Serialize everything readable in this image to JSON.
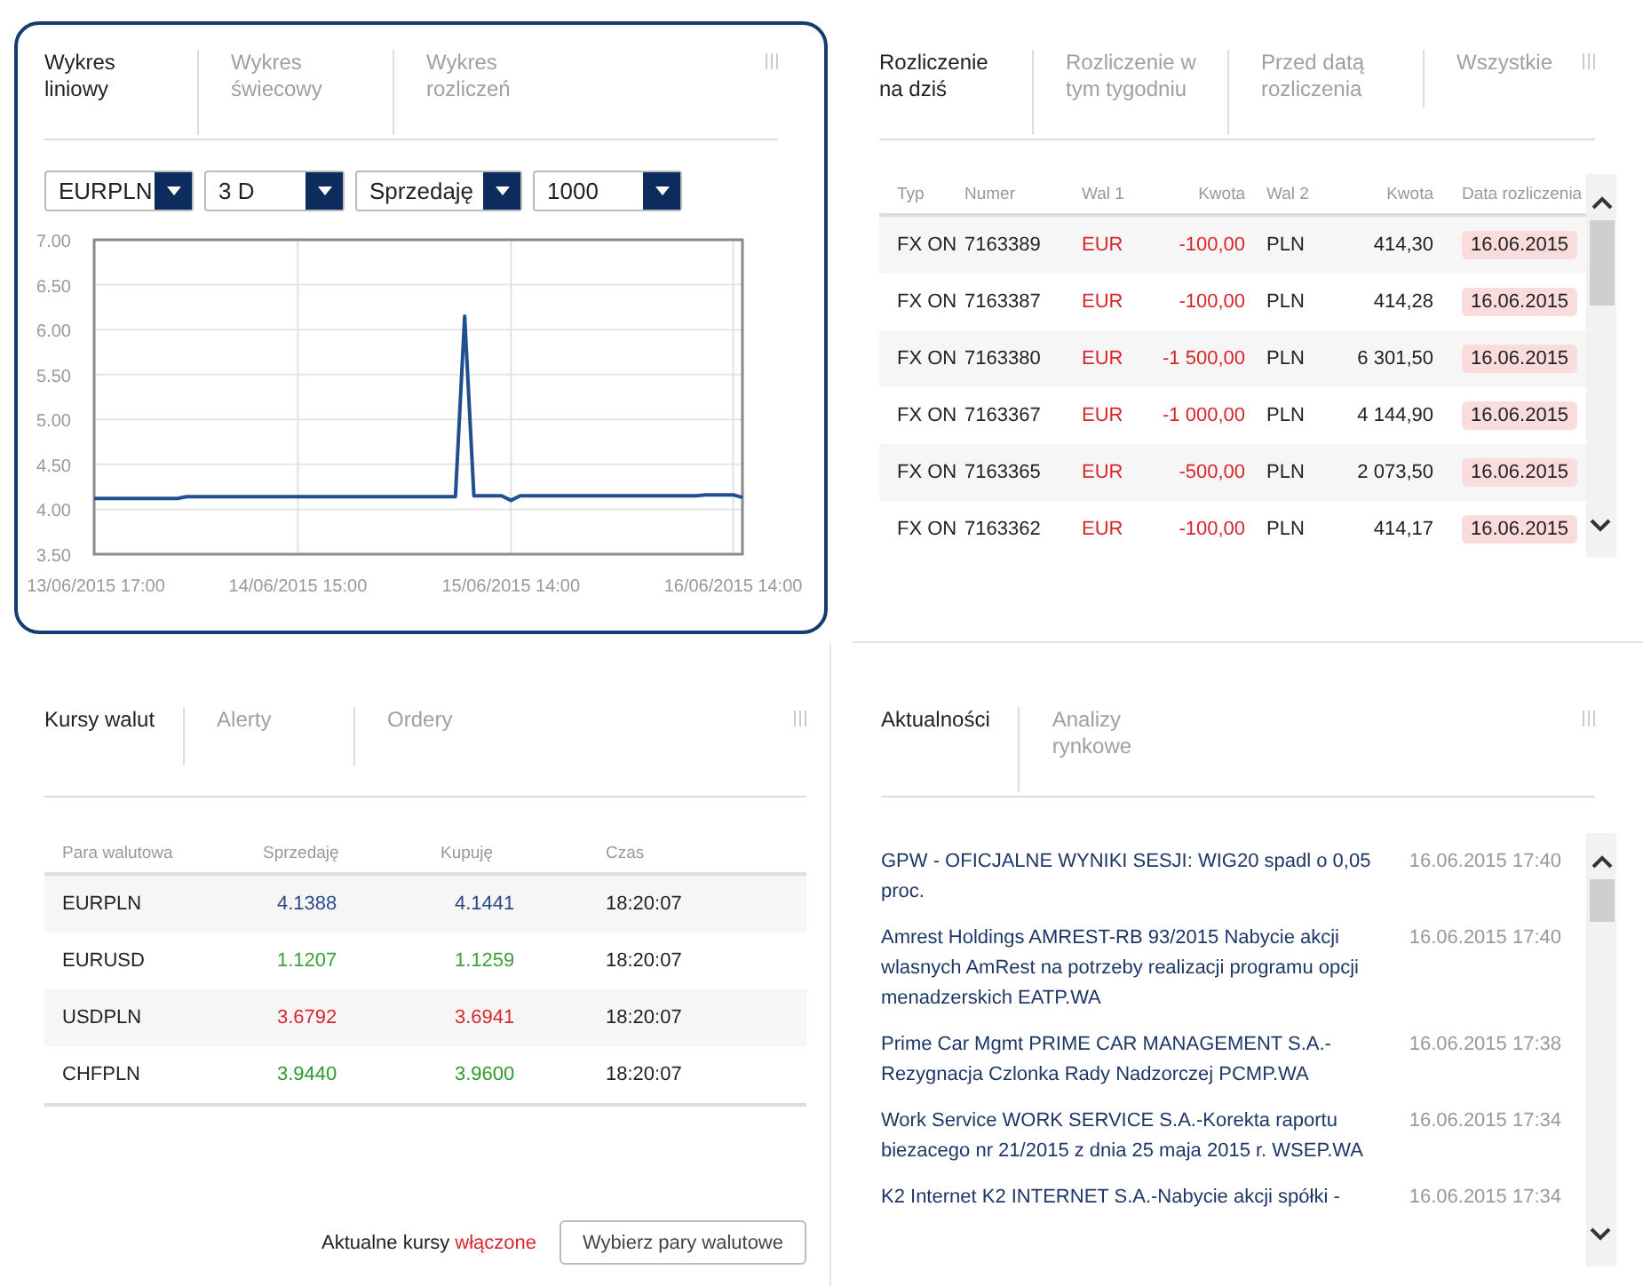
{
  "chart_panel": {
    "tabs": [
      {
        "label": "Wykres liniowy",
        "selected": true
      },
      {
        "label": "Wykres świecowy",
        "selected": false
      },
      {
        "label": "Wykres rozliczeń",
        "selected": false
      }
    ],
    "selects": [
      {
        "value": "EURPLN"
      },
      {
        "value": "3 D"
      },
      {
        "value": "Sprzedaję"
      },
      {
        "value": "1000"
      }
    ],
    "chart_data": {
      "type": "line",
      "categories": [
        "13/06/2015 17:00",
        null,
        null,
        null,
        null,
        null,
        null,
        null,
        null,
        null,
        null,
        null,
        null,
        null,
        null,
        null,
        null,
        null,
        null,
        null,
        null,
        null,
        "14/06/2015 15:00",
        null,
        null,
        null,
        null,
        null,
        null,
        null,
        null,
        null,
        null,
        null,
        null,
        null,
        null,
        null,
        null,
        null,
        null,
        null,
        null,
        null,
        null,
        "15/06/2015 14:00",
        null,
        null,
        null,
        null,
        null,
        null,
        null,
        null,
        null,
        null,
        null,
        null,
        null,
        null,
        null,
        null,
        null,
        null,
        null,
        null,
        null,
        null,
        null,
        "16/06/2015 14:00",
        null
      ],
      "series": [
        {
          "color": "#1f4f8f",
          "values": [
            4.12,
            4.12,
            4.12,
            4.12,
            4.12,
            4.12,
            4.12,
            4.12,
            4.12,
            4.12,
            4.14,
            4.14,
            4.14,
            4.14,
            4.14,
            4.14,
            4.14,
            4.14,
            4.14,
            4.14,
            4.14,
            4.14,
            4.14,
            4.14,
            4.14,
            4.14,
            4.14,
            4.14,
            4.14,
            4.14,
            4.14,
            4.14,
            4.14,
            4.14,
            4.14,
            4.14,
            4.14,
            4.14,
            4.14,
            4.14,
            6.15,
            4.15,
            4.15,
            4.15,
            4.15,
            4.1,
            4.15,
            4.15,
            4.15,
            4.15,
            4.15,
            4.15,
            4.15,
            4.15,
            4.15,
            4.15,
            4.15,
            4.15,
            4.15,
            4.15,
            4.15,
            4.15,
            4.15,
            4.15,
            4.15,
            4.15,
            4.16,
            4.16,
            4.16,
            4.16,
            4.13
          ]
        }
      ],
      "ylim": [
        3.5,
        7
      ],
      "grid": true,
      "yticks": [
        {
          "value": 7,
          "label": "7.00"
        },
        {
          "value": 6.5,
          "label": "6.50"
        },
        {
          "value": 6,
          "label": "6.00"
        },
        {
          "value": 5.5,
          "label": "5.50"
        },
        {
          "value": 5,
          "label": "5.00"
        },
        {
          "value": 4.5,
          "label": "4.50"
        },
        {
          "value": 4,
          "label": "4.00"
        },
        {
          "value": 3.5,
          "label": "3.50"
        }
      ]
    }
  },
  "settlement_panel": {
    "tabs": [
      {
        "label": "Rozliczenie na dziś",
        "selected": true
      },
      {
        "label": "Rozliczenie w tym tygodniu",
        "selected": false
      },
      {
        "label": "Przed datą rozliczenia",
        "selected": false
      },
      {
        "label": "Wszystkie",
        "selected": false
      }
    ],
    "table": {
      "columns": [
        "Typ",
        "Numer",
        "Wal 1",
        "Kwota",
        "Wal 2",
        "Kwota",
        "Data rozliczenia"
      ],
      "rows": [
        [
          "FX ON",
          "7163389",
          "EUR",
          "-100,00",
          "PLN",
          "414,30",
          "16.06.2015"
        ],
        [
          "FX ON",
          "7163387",
          "EUR",
          "-100,00",
          "PLN",
          "414,28",
          "16.06.2015"
        ],
        [
          "FX ON",
          "7163380",
          "EUR",
          "-1 500,00",
          "PLN",
          "6 301,50",
          "16.06.2015"
        ],
        [
          "FX ON",
          "7163367",
          "EUR",
          "-1 000,00",
          "PLN",
          "4 144,90",
          "16.06.2015"
        ],
        [
          "FX ON",
          "7163365",
          "EUR",
          "-500,00",
          "PLN",
          "2 073,50",
          "16.06.2015"
        ],
        [
          "FX ON",
          "7163362",
          "EUR",
          "-100,00",
          "PLN",
          "414,17",
          "16.06.2015"
        ]
      ]
    }
  },
  "rates_panel": {
    "tabs": [
      {
        "label": "Kursy walut",
        "selected": true
      },
      {
        "label": "Alerty",
        "selected": false
      },
      {
        "label": "Ordery",
        "selected": false
      }
    ],
    "table": {
      "columns": [
        "Para walutowa",
        "Sprzedaję",
        "Kupuję",
        "Czas"
      ],
      "rows": [
        {
          "pair": "EURPLN",
          "sell": "4.1388",
          "buy": "4.1441",
          "time": "18:20:07",
          "color": "#2c4a8a"
        },
        {
          "pair": "EURUSD",
          "sell": "1.1207",
          "buy": "1.1259",
          "time": "18:20:07",
          "color": "#3aa33a"
        },
        {
          "pair": "USDPLN",
          "sell": "3.6792",
          "buy": "3.6941",
          "time": "18:20:07",
          "color": "#d9262b"
        },
        {
          "pair": "CHFPLN",
          "sell": "3.9440",
          "buy": "3.9600",
          "time": "18:20:07",
          "color": "#2e9a2e"
        }
      ]
    },
    "footer": {
      "label": "Aktualne kursy",
      "status": "włączone",
      "button": "Wybierz pary walutowe"
    }
  },
  "news_panel": {
    "tabs": [
      {
        "label": "Aktualności",
        "selected": true
      },
      {
        "label": "Analizy rynkowe",
        "selected": false
      }
    ],
    "items": [
      {
        "headline": "GPW - OFICJALNE WYNIKI SESJI: WIG20 spadl o 0,05 proc.",
        "time": "16.06.2015 17:40"
      },
      {
        "headline": "Amrest Holdings AMREST-RB 93/2015 Nabycie akcji wlasnych AmRest na potrzeby realizacji programu opcji menadzerskich EATP.WA",
        "time": "16.06.2015 17:40"
      },
      {
        "headline": "Prime Car Mgmt PRIME CAR MANAGEMENT S.A.-Rezygnacja Czlonka Rady Nadzorczej PCMP.WA",
        "time": "16.06.2015 17:38"
      },
      {
        "headline": "Work Service WORK SERVICE S.A.-Korekta raportu biezacego nr 21/2015 z dnia 25 maja 2015 r. WSEP.WA",
        "time": "16.06.2015 17:34"
      },
      {
        "headline": "K2 Internet K2 INTERNET S.A.-Nabycie akcji spółki -",
        "time": "16.06.2015 17:34"
      }
    ]
  }
}
